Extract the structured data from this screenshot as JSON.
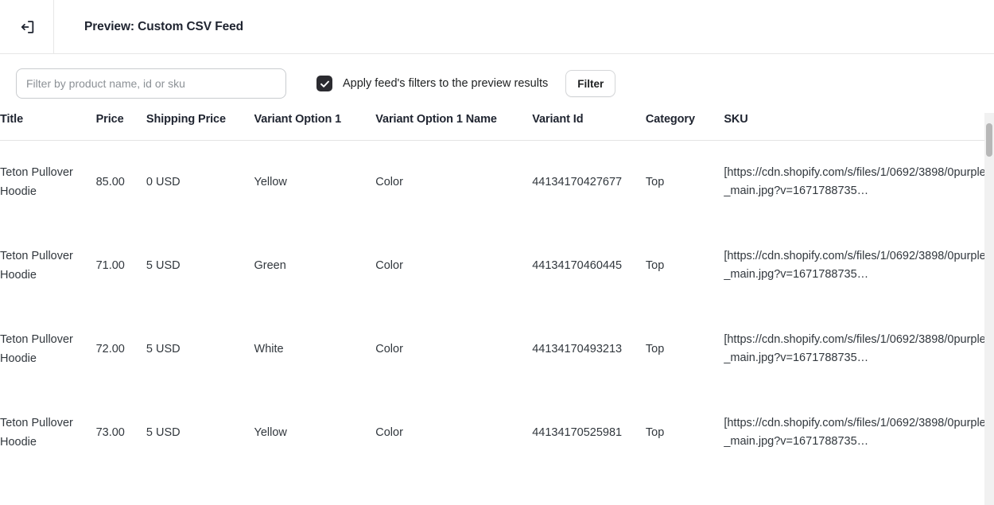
{
  "topbar": {
    "exit_icon": "exit-icon",
    "title": "Preview: Custom CSV Feed"
  },
  "filterbar": {
    "search": {
      "value": "",
      "placeholder": "Filter by product name, id or sku"
    },
    "apply_filters_checkbox": {
      "label": "Apply feed's filters to the preview results",
      "checked": true,
      "check_icon": "check-icon"
    },
    "filter_button_label": "Filter"
  },
  "table": {
    "columns": [
      "Title",
      "Price",
      "Shipping Price",
      "Variant Option 1",
      "Variant Option 1 Name",
      "Variant Id",
      "Category",
      "SKU"
    ],
    "rows": [
      {
        "title": "Teton Pullover Hoodie",
        "price": "85.00",
        "shipping_price": "0 USD",
        "variant_option_1": "Yellow",
        "variant_option_1_name": "Color",
        "variant_id": "44134170427677",
        "category": "Top",
        "sku": "[https://cdn.shopify.com/s/files/1/0692/3898/0purple_main.jpg?v=1671788735…"
      },
      {
        "title": "Teton Pullover Hoodie",
        "price": "71.00",
        "shipping_price": "5 USD",
        "variant_option_1": "Green",
        "variant_option_1_name": "Color",
        "variant_id": "44134170460445",
        "category": "Top",
        "sku": "[https://cdn.shopify.com/s/files/1/0692/3898/0purple_main.jpg?v=1671788735…"
      },
      {
        "title": "Teton Pullover Hoodie",
        "price": "72.00",
        "shipping_price": "5 USD",
        "variant_option_1": "White",
        "variant_option_1_name": "Color",
        "variant_id": "44134170493213",
        "category": "Top",
        "sku": "[https://cdn.shopify.com/s/files/1/0692/3898/0purple_main.jpg?v=1671788735…"
      },
      {
        "title": "Teton Pullover Hoodie",
        "price": "73.00",
        "shipping_price": "5 USD",
        "variant_option_1": "Yellow",
        "variant_option_1_name": "Color",
        "variant_id": "44134170525981",
        "category": "Top",
        "sku": "[https://cdn.shopify.com/s/files/1/0692/3898/0purple_main.jpg?v=1671788735…"
      }
    ]
  },
  "colors": {
    "text": "#202223",
    "heading": "#1f2430",
    "border": "#e3e3e3",
    "placeholder": "#8c9196",
    "checkbox_fill": "#2b2b30",
    "scrollbar_thumb": "#b7b7b7",
    "scrollbar_track": "#f1f1f1"
  }
}
